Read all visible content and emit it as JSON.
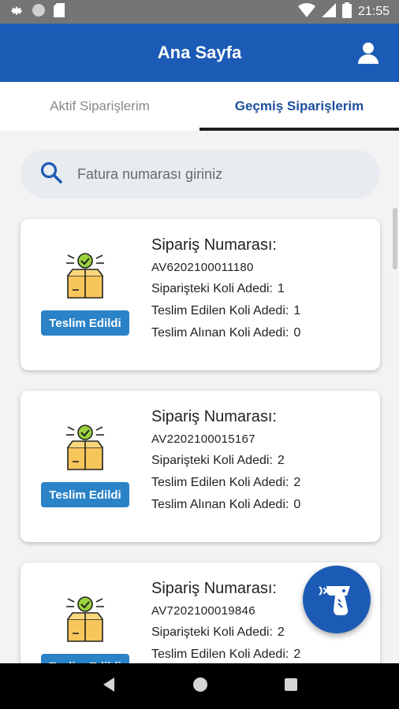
{
  "status_bar": {
    "time": "21:55"
  },
  "app_bar": {
    "title": "Ana Sayfa"
  },
  "tabs": [
    {
      "label": "Aktif Siparişlerim",
      "active": false
    },
    {
      "label": "Geçmiş Siparişlerim",
      "active": true
    }
  ],
  "search": {
    "placeholder": "Fatura numarası giriniz",
    "value": ""
  },
  "orders": [
    {
      "status": "Teslim Edildi",
      "order_label": "Sipariş Numarası:",
      "order_number": "AV6202100011180",
      "rows": [
        {
          "label": "Siparişteki Koli Adedi:",
          "value": "1"
        },
        {
          "label": "Teslim Edilen Koli Adedi:",
          "value": "1"
        },
        {
          "label": "Teslim Alınan Koli Adedi:",
          "value": "0"
        }
      ]
    },
    {
      "status": "Teslim Edildi",
      "order_label": "Sipariş Numarası:",
      "order_number": "AV2202100015167",
      "rows": [
        {
          "label": "Siparişteki Koli Adedi:",
          "value": "2"
        },
        {
          "label": "Teslim Edilen Koli Adedi:",
          "value": "2"
        },
        {
          "label": "Teslim Alınan Koli Adedi:",
          "value": "0"
        }
      ]
    },
    {
      "status": "Teslim Edildi",
      "order_label": "Sipariş Numarası:",
      "order_number": "AV7202100019846",
      "rows": [
        {
          "label": "Siparişteki Koli Adedi:",
          "value": "2"
        },
        {
          "label": "Teslim Edilen Koli Adedi:",
          "value": "2"
        }
      ]
    }
  ],
  "colors": {
    "primary": "#1c5bb5",
    "badge": "#2a82c7",
    "active_tab": "#1c4f9c"
  }
}
